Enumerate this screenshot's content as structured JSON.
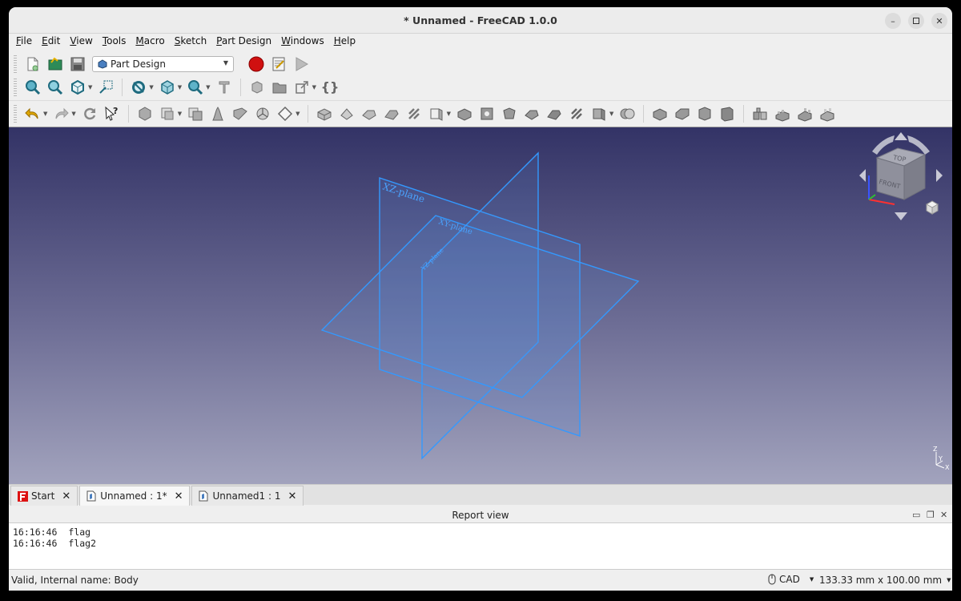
{
  "window": {
    "title": "* Unnamed - FreeCAD 1.0.0"
  },
  "menu": [
    {
      "u": "F",
      "rest": "ile"
    },
    {
      "u": "E",
      "rest": "dit"
    },
    {
      "u": "V",
      "rest": "iew"
    },
    {
      "u": "T",
      "rest": "ools"
    },
    {
      "u": "M",
      "rest": "acro"
    },
    {
      "u": "S",
      "rest": "ketch"
    },
    {
      "u": "P",
      "rest": "art Design"
    },
    {
      "u": "W",
      "rest": "indows"
    },
    {
      "u": "H",
      "rest": "elp"
    }
  ],
  "workbench": {
    "selected": "Part Design"
  },
  "viewport": {
    "planes": {
      "xz": "XZ-plane",
      "xy": "XY-plane",
      "yz": "YZ-plane"
    },
    "navcube": {
      "top": "TOP",
      "front": "FRONT"
    },
    "axes": {
      "z": "Z",
      "y": "Y",
      "x": "X"
    }
  },
  "tabs": [
    {
      "label": "Start",
      "active": false
    },
    {
      "label": "Unnamed : 1*",
      "active": true
    },
    {
      "label": "Unnamed1 : 1",
      "active": false
    }
  ],
  "report": {
    "title": "Report view",
    "lines": [
      {
        "time": "16:16:46",
        "msg": "flag"
      },
      {
        "time": "16:16:46",
        "msg": "flag2"
      }
    ]
  },
  "status": {
    "message": "Valid, Internal name: Body",
    "nav_style": "CAD",
    "dimensions": "133.33 mm x 100.00 mm"
  },
  "colors": {
    "accent": "#3399ff",
    "record": "#cc1111"
  }
}
